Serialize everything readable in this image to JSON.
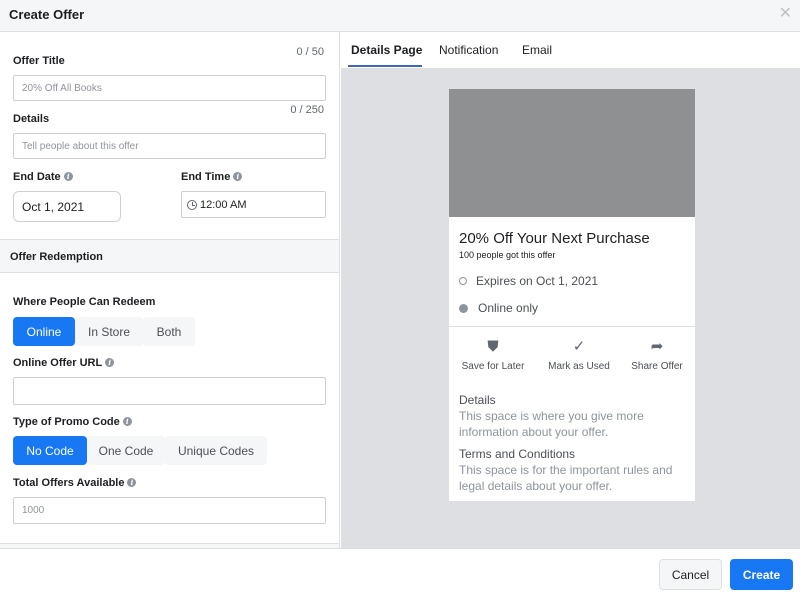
{
  "dialog": {
    "title": "Create Offer",
    "close_icon": "close-icon"
  },
  "form": {
    "offer_title": {
      "label": "Offer Title",
      "counter": "0 / 50",
      "placeholder": "20% Off All Books",
      "value": ""
    },
    "details": {
      "label": "Details",
      "counter": "0 / 250",
      "placeholder": "Tell people about this offer",
      "value": ""
    },
    "end_date": {
      "label": "End Date",
      "value": "Oct 1, 2021"
    },
    "end_time": {
      "label": "End Time",
      "value": "12:00 AM"
    },
    "redemption_section_title": "Offer Redemption",
    "where_redeem": {
      "label": "Where People Can Redeem",
      "options": [
        "Online",
        "In Store",
        "Both"
      ],
      "selected": "Online"
    },
    "online_url": {
      "label": "Online Offer URL",
      "value": ""
    },
    "promo_code": {
      "label": "Type of Promo Code",
      "options": [
        "No Code",
        "One Code",
        "Unique Codes"
      ],
      "selected": "No Code"
    },
    "total_offers": {
      "label": "Total Offers Available",
      "placeholder": "1000",
      "value": ""
    }
  },
  "preview": {
    "tabs": [
      {
        "label": "Details Page",
        "active": true
      },
      {
        "label": "Notification",
        "active": false
      },
      {
        "label": "Email",
        "active": false
      }
    ],
    "card": {
      "title": "20% Off Your Next Purchase",
      "subtitle": "100 people got this offer",
      "expires": "Expires on Oct 1, 2021",
      "channel": "Online only",
      "actions": [
        {
          "label": "Save for Later",
          "icon": "save-icon"
        },
        {
          "label": "Mark as Used",
          "icon": "check-icon"
        },
        {
          "label": "Share Offer",
          "icon": "share-icon"
        }
      ],
      "details_heading": "Details",
      "details_text": "This space is where you give more information about your offer.",
      "terms_heading": "Terms and Conditions",
      "terms_text": "This space is for the important rules and legal details about your offer."
    }
  },
  "footer": {
    "cancel_label": "Cancel",
    "create_label": "Create"
  },
  "colors": {
    "primary": "#1877f2",
    "tab_underline": "#4267b2",
    "preview_bg": "#dddfe2",
    "image_placeholder": "#8e9091"
  }
}
